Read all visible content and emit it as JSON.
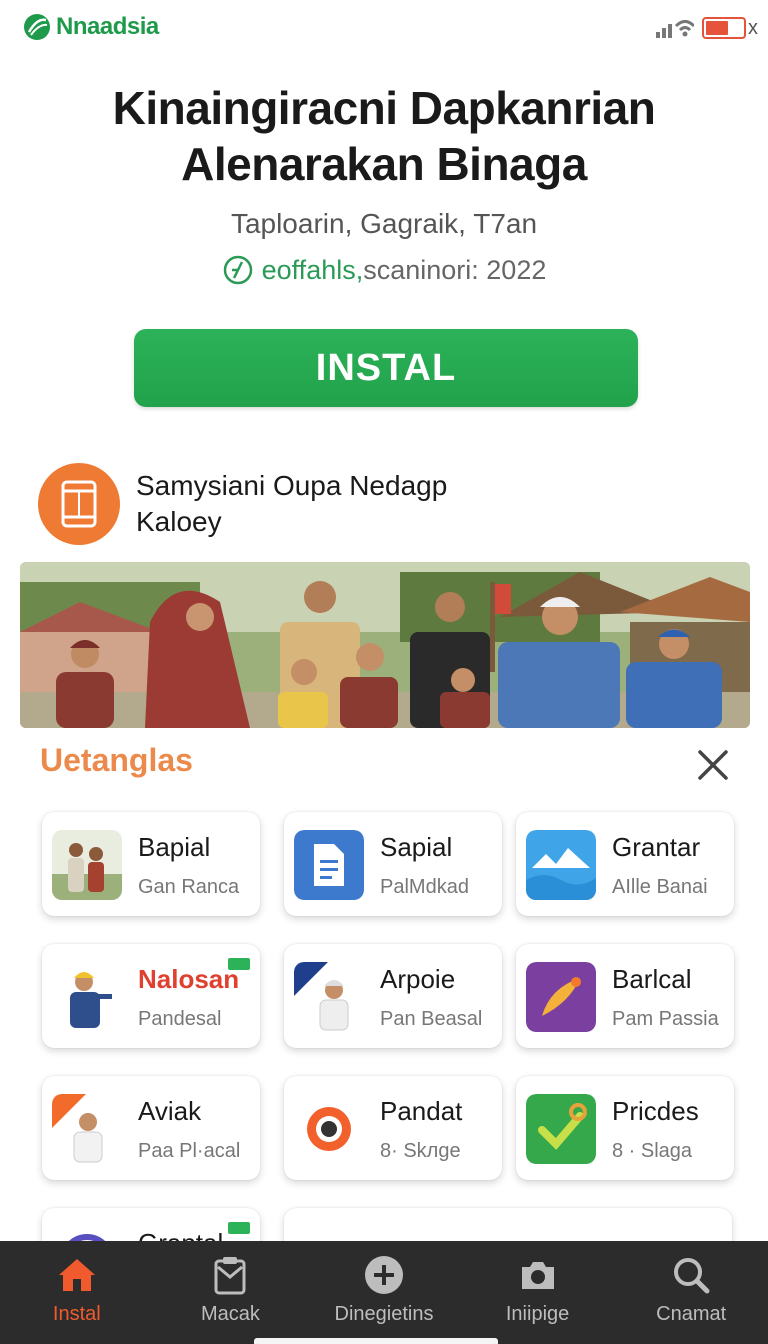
{
  "status": {
    "brand_name": "Nnaadsia",
    "close_glyph": "x",
    "battery_level": 0.6,
    "brand_color": "#1e9a4a"
  },
  "app": {
    "title_line1": "Kinaingiracni Dapkanrian",
    "title_line2": "Alenarakan Binaga",
    "subtitle": "Taploarin, Gagraik, T7an",
    "meta_highlight": "eoffahls,",
    "meta_rest": "scaninori: 2022",
    "install_label": "INSTAL",
    "accent_green": "#21a24b"
  },
  "developer": {
    "line1": "Samysiani Oupa Nedagp",
    "line2": "Kaloey",
    "icon": "phone-icon",
    "icon_color": "#ef7a33"
  },
  "sheet": {
    "title": "Uetanglas",
    "title_color": "#ec8a4c",
    "cards": [
      {
        "name": "Bapial",
        "meta": "Gan Ranca",
        "icon": "people-photo"
      },
      {
        "name": "Sapial",
        "meta": "PalMdkad",
        "icon": "document-icon"
      },
      {
        "name": "Grantar",
        "meta": "AIlle Banai",
        "icon": "landscape-icon"
      },
      {
        "name": "Nalosan",
        "meta": "Pandesal",
        "icon": "worker-photo"
      },
      {
        "name": "Arpoie",
        "meta": "Pan Beasal",
        "icon": "child-photo"
      },
      {
        "name": "Barlcal",
        "meta": "Pam Passia",
        "icon": "comet-icon"
      },
      {
        "name": "Aviak",
        "meta": "Paa Pl·acal",
        "icon": "child-photo"
      },
      {
        "name": "Pandat",
        "meta": "8· Skлge",
        "icon": "record-icon"
      },
      {
        "name": "Pricdes",
        "meta": "8 · Slaga",
        "icon": "check-icon"
      },
      {
        "name": "Graptal",
        "meta": "",
        "icon": "circle-icon"
      }
    ]
  },
  "nav": {
    "items": [
      {
        "label": "Instal",
        "icon": "home-icon"
      },
      {
        "label": "Macak",
        "icon": "clipboard-icon"
      },
      {
        "label": "Dinegietins",
        "icon": "plus-circle-icon"
      },
      {
        "label": "Iniipige",
        "icon": "camera-icon"
      },
      {
        "label": "Cnamat",
        "icon": "search-icon"
      }
    ],
    "active_color": "#f15a2c"
  }
}
